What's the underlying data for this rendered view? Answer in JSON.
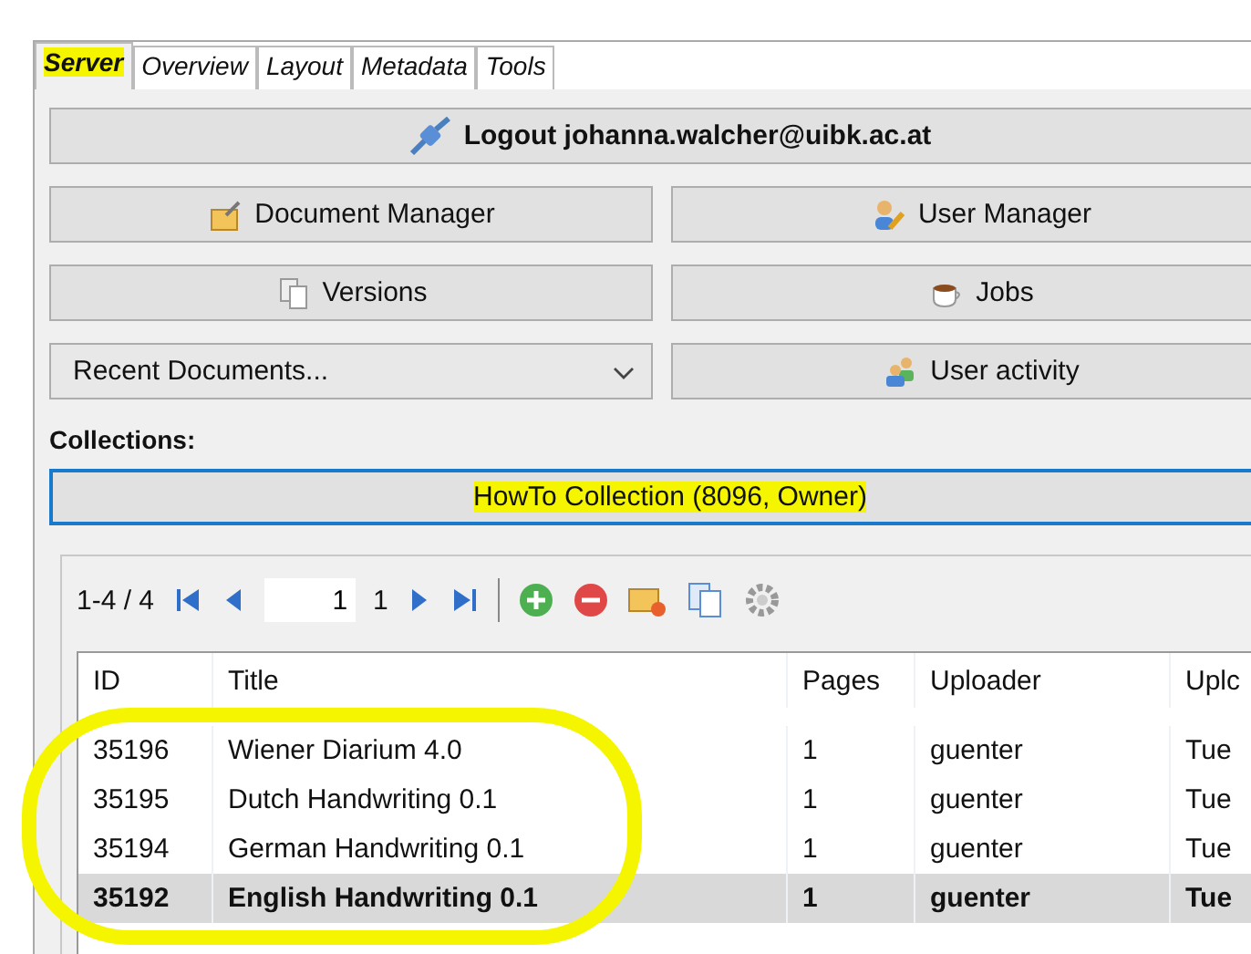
{
  "tabs": [
    {
      "label": "Server",
      "selected": true,
      "highlighted": true
    },
    {
      "label": "Overview",
      "selected": false,
      "highlighted": false
    },
    {
      "label": "Layout",
      "selected": false,
      "highlighted": false
    },
    {
      "label": "Metadata",
      "selected": false,
      "highlighted": false
    },
    {
      "label": "Tools",
      "selected": false,
      "highlighted": false
    }
  ],
  "logout_button": "Logout johanna.walcher@uibk.ac.at",
  "buttons": [
    {
      "kind": "document",
      "label": "Document Manager"
    },
    {
      "kind": "users",
      "label": "User Manager"
    },
    {
      "kind": "versions",
      "label": "Versions"
    },
    {
      "kind": "jobs",
      "label": "Jobs"
    },
    {
      "kind": "dropdown",
      "label": "Recent Documents..."
    },
    {
      "kind": "activity",
      "label": "User activity"
    }
  ],
  "collections": {
    "label": "Collections:",
    "value": "HowTo Collection (8096, Owner)",
    "highlighted": true
  },
  "pager": {
    "range": "1-4 / 4",
    "page": "1",
    "total": "1"
  },
  "table": {
    "columns": [
      "ID",
      "Title",
      "Pages",
      "Uploader",
      "Uplc"
    ],
    "rows": [
      {
        "cells": [
          "35196",
          "Wiener Diarium 4.0",
          "1",
          "guenter",
          "Tue"
        ],
        "selected": false
      },
      {
        "cells": [
          "35195",
          "Dutch Handwriting 0.1",
          "1",
          "guenter",
          "Tue"
        ],
        "selected": false
      },
      {
        "cells": [
          "35194",
          "German Handwriting 0.1",
          "1",
          "guenter",
          "Tue"
        ],
        "selected": false
      },
      {
        "cells": [
          "35192",
          "English Handwriting 0.1",
          "1",
          "guenter",
          "Tue"
        ],
        "selected": true
      }
    ]
  }
}
